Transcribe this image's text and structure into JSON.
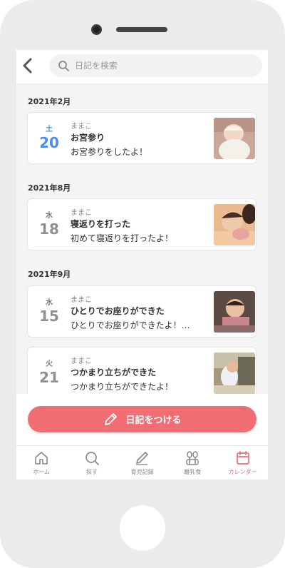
{
  "search": {
    "placeholder": "日記を検索"
  },
  "months": [
    {
      "label": "2021年2月"
    },
    {
      "label": "2021年8月"
    },
    {
      "label": "2021年9月"
    }
  ],
  "entries": [
    {
      "dow": "土",
      "day": "20",
      "author": "ままこ",
      "title": "お宮参り",
      "body": "お宮参りをしたよ！"
    },
    {
      "dow": "水",
      "day": "18",
      "author": "ままこ",
      "title": "寝返りを打った",
      "body": "初めて寝返りを打ったよ！"
    },
    {
      "dow": "水",
      "day": "15",
      "author": "ままこ",
      "title": "ひとりでお座りができた",
      "body": "ひとりでお座りができたよ！…"
    },
    {
      "dow": "火",
      "day": "21",
      "author": "ままこ",
      "title": "つかまり立ちができた",
      "body": "つかまり立ちができたよ！"
    }
  ],
  "action": {
    "write_label": "日記をつける"
  },
  "tabs": [
    {
      "label": "ホーム",
      "icon": "home-icon"
    },
    {
      "label": "探す",
      "icon": "search-icon"
    },
    {
      "label": "育児記録",
      "icon": "pencil-icon"
    },
    {
      "label": "離乳食",
      "icon": "utensils-icon"
    },
    {
      "label": "カレンダー",
      "icon": "calendar-icon",
      "active": true
    }
  ],
  "colors": {
    "accent": "#f06e73",
    "saturday": "#4a90e2",
    "list_bg": "#f4f4f4"
  }
}
